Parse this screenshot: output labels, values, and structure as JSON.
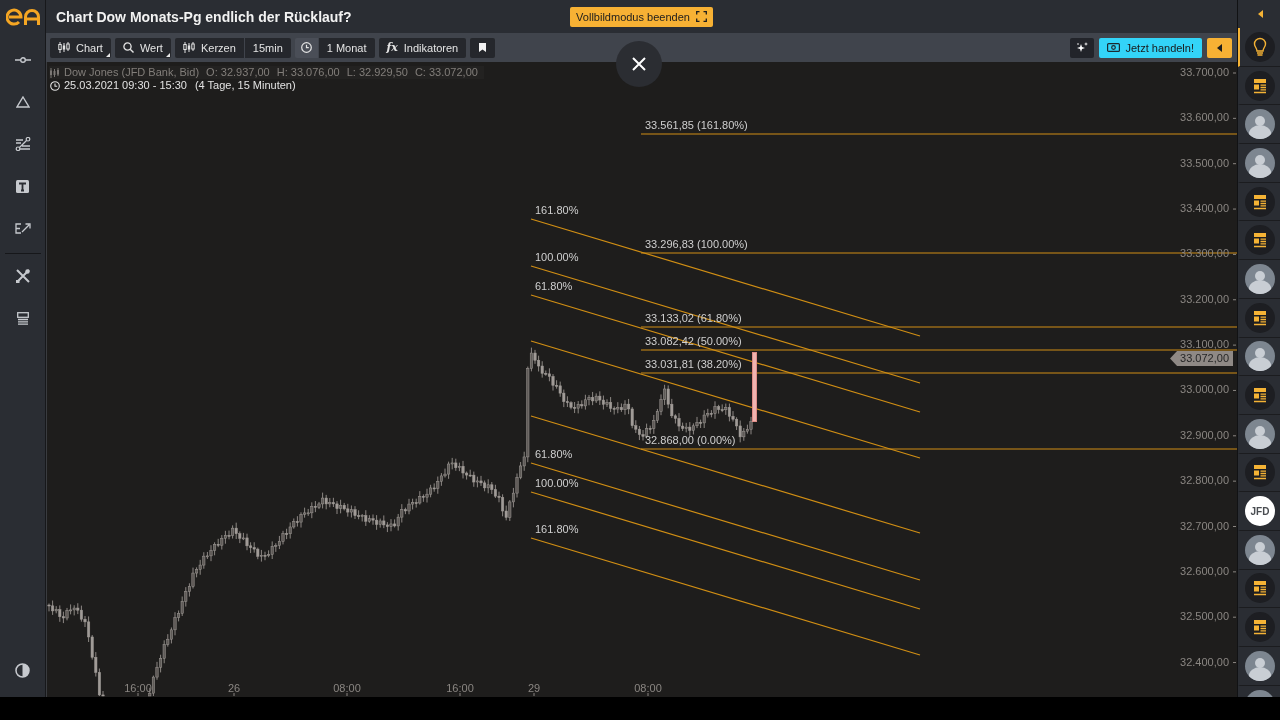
{
  "header": {
    "title": "Chart Dow Monats-Pg endlich der Rücklauf?",
    "exit_fullscreen": "Vollbildmodus beenden"
  },
  "toolbar": {
    "groups": [
      [
        {
          "kind": "chart",
          "label": "Chart",
          "dropdown": true
        }
      ],
      [
        {
          "kind": "search",
          "label": "Wert",
          "dropdown": true
        }
      ],
      [
        {
          "kind": "candles",
          "label": "Kerzen",
          "dropdown": false
        },
        {
          "kind": "interval",
          "label": "15min",
          "dropdown": false
        }
      ],
      [
        {
          "kind": "clock",
          "dropdown": false
        },
        {
          "kind": "range",
          "label": "1 Monat",
          "dropdown": false
        }
      ],
      [
        {
          "kind": "indicators",
          "icon": "fx",
          "label": "Indikatoren",
          "dropdown": false
        }
      ],
      [
        {
          "kind": "bookmark",
          "dropdown": false
        }
      ]
    ],
    "trade_button": "Jetzt handeln!"
  },
  "chart": {
    "info": {
      "instrument": "Dow Jones (JFD Bank, Bid)",
      "ohlc": [
        "O: 32.937,00",
        "H: 33.076,00",
        "L: 32.929,50",
        "C: 33.072,00"
      ],
      "period": "25.03.2021 09:30 - 15:30",
      "duration": "(4 Tage, 15 Minuten)"
    },
    "price_axis": [
      "33.700,00",
      "33.600,00",
      "33.500,00",
      "33.400,00",
      "33.300,00",
      "33.200,00",
      "33.100,00",
      "33.000,00",
      "32.900,00",
      "32.800,00",
      "32.700,00",
      "32.600,00",
      "32.500,00",
      "32.400,00"
    ],
    "current_price": "33.072,00",
    "time_axis": [
      "16:00",
      "26",
      "08:00",
      "16:00",
      "29",
      "08:00"
    ],
    "retracement_levels": [
      "33.561,85 (161.80%)",
      "33.296,83 (100.00%)",
      "33.133,02 (61.80%)",
      "33.082,42 (50.00%)",
      "33.031,81 (38.20%)",
      "32.868,00 (0.00%)"
    ],
    "channel_levels": [
      "161.80%",
      "100.00%",
      "61.80%",
      "61.80%",
      "100.00%",
      "161.80%"
    ]
  },
  "right_sidebar": {
    "items": [
      {
        "kind": "ideas",
        "selected": true
      },
      {
        "kind": "news",
        "selected": false
      },
      {
        "kind": "avatar",
        "selected": false
      },
      {
        "kind": "avatar",
        "selected": false
      },
      {
        "kind": "news",
        "selected": false
      },
      {
        "kind": "news",
        "selected": false
      },
      {
        "kind": "avatar",
        "selected": false
      },
      {
        "kind": "news",
        "selected": false
      },
      {
        "kind": "avatar",
        "selected": false
      },
      {
        "kind": "news",
        "selected": false
      },
      {
        "kind": "avatar",
        "selected": false
      },
      {
        "kind": "news",
        "selected": false
      },
      {
        "kind": "logo",
        "label": "JFD",
        "selected": false
      },
      {
        "kind": "avatar",
        "selected": false
      },
      {
        "kind": "news",
        "selected": false
      },
      {
        "kind": "news",
        "selected": false
      },
      {
        "kind": "avatar",
        "selected": false
      },
      {
        "kind": "avatar",
        "selected": false
      }
    ]
  }
}
